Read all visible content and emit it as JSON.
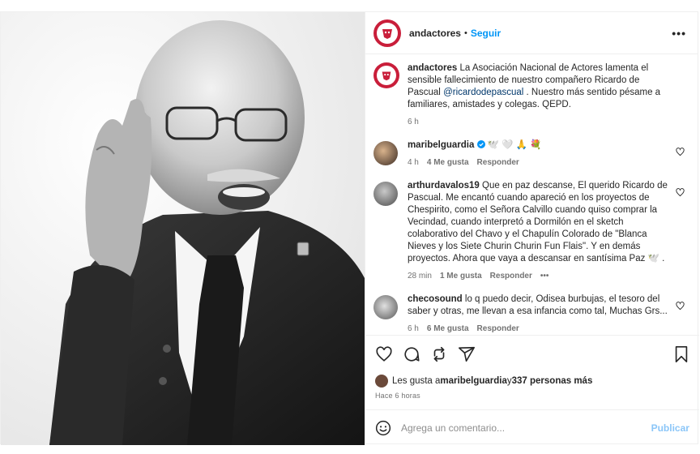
{
  "colors": {
    "accent": "#0095f6",
    "brand": "#c91e3a"
  },
  "header": {
    "username": "andactores",
    "separator": "•",
    "follow_label": "Seguir",
    "more_icon": "more-horizontal-icon",
    "more_label": "•••"
  },
  "caption": {
    "username": "andactores",
    "text_before": " La Asociación Nacional de Actores lamenta el sensible fallecimiento de nuestro compañero Ricardo de Pascual ",
    "mention": "@ricardodepascual",
    "text_after": " . Nuestro más sentido pésame a familiares, amistades y colegas. QEPD.",
    "time": "6 h"
  },
  "comments": [
    {
      "username": "maribelguardia",
      "verified": true,
      "text": " 🕊️ 🤍 🙏 💐",
      "time": "4 h",
      "likes": "4 Me gusta",
      "reply": "Responder"
    },
    {
      "username": "arthurdavalos19",
      "text": " Que en paz descanse, El querido Ricardo de Pascual. Me encantó cuando apareció en los proyectos de Chespirito, como el Señora Calvillo cuando quiso comprar la Vecindad, cuando interpretó a Dormilón en el sketch colaborativo del Chavo y el Chapulín Colorado de \"Blanca Nieves y los Siete Churin Churin Fun Flais\". Y en demás proyectos. Ahora que vaya a descansar en santísima Paz 🕊️ .",
      "time": "28 min",
      "likes": "1 Me gusta",
      "reply": "Responder",
      "more": "•••"
    },
    {
      "username": "checosound",
      "text": " lo q puedo decir, Odisea burbujas, el tesoro del saber y otras, me llevan a esa infancia como tal, Muchas Grs...",
      "time": "6 h",
      "likes": "6 Me gusta",
      "reply": "Responder"
    }
  ],
  "likes": {
    "prefix": "Les gusta a ",
    "user": "maribelguardia",
    "connector": " y ",
    "others": "337 personas más"
  },
  "posted": "Hace 6 horas",
  "add_comment": {
    "placeholder": "Agrega un comentario...",
    "publish": "Publicar"
  }
}
